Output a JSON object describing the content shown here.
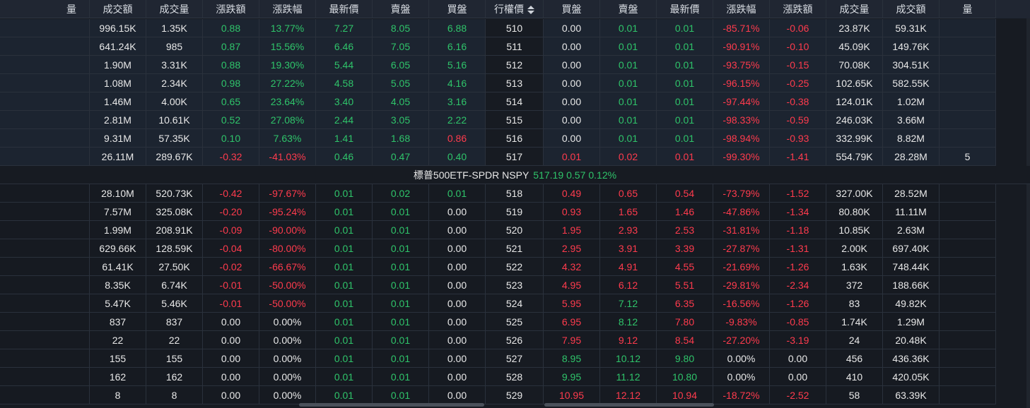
{
  "columns": [
    {
      "key": "c0",
      "label": "量"
    },
    {
      "key": "c1",
      "label": "成交額"
    },
    {
      "key": "c2",
      "label": "成交量"
    },
    {
      "key": "c3",
      "label": "漲跌額"
    },
    {
      "key": "c4",
      "label": "漲跌幅"
    },
    {
      "key": "c5",
      "label": "最新價"
    },
    {
      "key": "c6",
      "label": "賣盤"
    },
    {
      "key": "c7",
      "label": "買盤"
    },
    {
      "key": "c8",
      "label": "行權價"
    },
    {
      "key": "c9",
      "label": "買盤"
    },
    {
      "key": "c10",
      "label": "賣盤"
    },
    {
      "key": "c11",
      "label": "最新價"
    },
    {
      "key": "c12",
      "label": "漲跌幅"
    },
    {
      "key": "c13",
      "label": "漲跌額"
    },
    {
      "key": "c14",
      "label": "成交量"
    },
    {
      "key": "c15",
      "label": "成交額"
    },
    {
      "key": "c16",
      "label": "量"
    }
  ],
  "underlying": {
    "name": "標普500ETF-SPDR NSPY",
    "price": "517.19",
    "change": "0.57",
    "pct": "0.12%"
  },
  "rows_top": [
    {
      "call": [
        "",
        "996.15K",
        "1.35K",
        "0.88",
        "13.77%",
        "7.27",
        "8.05",
        "6.88"
      ],
      "strike": "510",
      "put": [
        "0.00",
        "0.01",
        "0.01",
        "-85.71%",
        "-0.06",
        "23.87K",
        "59.31K",
        ""
      ],
      "cc": [
        "nu",
        "nu",
        "nu",
        "up",
        "up",
        "up",
        "up",
        "up"
      ],
      "pc": [
        "nu",
        "up",
        "up",
        "dn",
        "dn",
        "nu",
        "nu",
        "nu"
      ]
    },
    {
      "call": [
        "",
        "641.24K",
        "985",
        "0.87",
        "15.56%",
        "6.46",
        "7.05",
        "6.16"
      ],
      "strike": "511",
      "put": [
        "0.00",
        "0.01",
        "0.01",
        "-90.91%",
        "-0.10",
        "45.09K",
        "149.76K",
        ""
      ],
      "cc": [
        "nu",
        "nu",
        "nu",
        "up",
        "up",
        "up",
        "up",
        "up"
      ],
      "pc": [
        "nu",
        "up",
        "up",
        "dn",
        "dn",
        "nu",
        "nu",
        "nu"
      ]
    },
    {
      "call": [
        "",
        "1.90M",
        "3.31K",
        "0.88",
        "19.30%",
        "5.44",
        "6.05",
        "5.16"
      ],
      "strike": "512",
      "put": [
        "0.00",
        "0.01",
        "0.01",
        "-93.75%",
        "-0.15",
        "70.08K",
        "304.51K",
        ""
      ],
      "cc": [
        "nu",
        "nu",
        "nu",
        "up",
        "up",
        "up",
        "up",
        "up"
      ],
      "pc": [
        "nu",
        "up",
        "up",
        "dn",
        "dn",
        "nu",
        "nu",
        "nu"
      ]
    },
    {
      "call": [
        "",
        "1.08M",
        "2.34K",
        "0.98",
        "27.22%",
        "4.58",
        "5.05",
        "4.16"
      ],
      "strike": "513",
      "put": [
        "0.00",
        "0.01",
        "0.01",
        "-96.15%",
        "-0.25",
        "102.65K",
        "582.55K",
        ""
      ],
      "cc": [
        "nu",
        "nu",
        "nu",
        "up",
        "up",
        "up",
        "up",
        "up"
      ],
      "pc": [
        "nu",
        "up",
        "up",
        "dn",
        "dn",
        "nu",
        "nu",
        "nu"
      ]
    },
    {
      "call": [
        "",
        "1.46M",
        "4.00K",
        "0.65",
        "23.64%",
        "3.40",
        "4.05",
        "3.16"
      ],
      "strike": "514",
      "put": [
        "0.00",
        "0.01",
        "0.01",
        "-97.44%",
        "-0.38",
        "124.01K",
        "1.02M",
        ""
      ],
      "cc": [
        "nu",
        "nu",
        "nu",
        "up",
        "up",
        "up",
        "up",
        "up"
      ],
      "pc": [
        "nu",
        "up",
        "up",
        "dn",
        "dn",
        "nu",
        "nu",
        "nu"
      ]
    },
    {
      "call": [
        "",
        "2.81M",
        "10.61K",
        "0.52",
        "27.08%",
        "2.44",
        "3.05",
        "2.22"
      ],
      "strike": "515",
      "put": [
        "0.00",
        "0.01",
        "0.01",
        "-98.33%",
        "-0.59",
        "246.03K",
        "3.66M",
        ""
      ],
      "cc": [
        "nu",
        "nu",
        "nu",
        "up",
        "up",
        "up",
        "up",
        "up"
      ],
      "pc": [
        "nu",
        "up",
        "up",
        "dn",
        "dn",
        "nu",
        "nu",
        "nu"
      ]
    },
    {
      "call": [
        "",
        "9.31M",
        "57.35K",
        "0.10",
        "7.63%",
        "1.41",
        "1.68",
        "0.86"
      ],
      "strike": "516",
      "put": [
        "0.00",
        "0.01",
        "0.01",
        "-98.94%",
        "-0.93",
        "332.99K",
        "8.82M",
        ""
      ],
      "cc": [
        "nu",
        "nu",
        "nu",
        "up",
        "up",
        "up",
        "up",
        "dn"
      ],
      "pc": [
        "nu",
        "up",
        "up",
        "dn",
        "dn",
        "nu",
        "nu",
        "nu"
      ]
    },
    {
      "call": [
        "",
        "26.11M",
        "289.67K",
        "-0.32",
        "-41.03%",
        "0.46",
        "0.47",
        "0.40"
      ],
      "strike": "517",
      "put": [
        "0.01",
        "0.02",
        "0.01",
        "-99.30%",
        "-1.41",
        "554.79K",
        "28.28M",
        "5"
      ],
      "cc": [
        "nu",
        "nu",
        "nu",
        "dn",
        "dn",
        "up",
        "up",
        "up"
      ],
      "pc": [
        "dn",
        "dn",
        "dn",
        "dn",
        "dn",
        "nu",
        "nu",
        "nu"
      ]
    }
  ],
  "rows_bottom": [
    {
      "call": [
        "",
        "28.10M",
        "520.73K",
        "-0.42",
        "-97.67%",
        "0.01",
        "0.02",
        "0.01"
      ],
      "strike": "518",
      "put": [
        "0.49",
        "0.65",
        "0.54",
        "-73.79%",
        "-1.52",
        "327.00K",
        "28.52M",
        ""
      ],
      "cc": [
        "nu",
        "nu",
        "nu",
        "dn",
        "dn",
        "up",
        "up",
        "up"
      ],
      "pc": [
        "dn",
        "dn",
        "dn",
        "dn",
        "dn",
        "nu",
        "nu",
        "nu"
      ]
    },
    {
      "call": [
        "",
        "7.57M",
        "325.08K",
        "-0.20",
        "-95.24%",
        "0.01",
        "0.01",
        "0.00"
      ],
      "strike": "519",
      "put": [
        "0.93",
        "1.65",
        "1.46",
        "-47.86%",
        "-1.34",
        "80.80K",
        "11.11M",
        ""
      ],
      "cc": [
        "nu",
        "nu",
        "nu",
        "dn",
        "dn",
        "up",
        "up",
        "nu"
      ],
      "pc": [
        "dn",
        "dn",
        "dn",
        "dn",
        "dn",
        "nu",
        "nu",
        "nu"
      ]
    },
    {
      "call": [
        "",
        "1.99M",
        "208.91K",
        "-0.09",
        "-90.00%",
        "0.01",
        "0.01",
        "0.00"
      ],
      "strike": "520",
      "put": [
        "1.95",
        "2.93",
        "2.53",
        "-31.81%",
        "-1.18",
        "10.85K",
        "2.63M",
        ""
      ],
      "cc": [
        "nu",
        "nu",
        "nu",
        "dn",
        "dn",
        "up",
        "up",
        "nu"
      ],
      "pc": [
        "dn",
        "dn",
        "dn",
        "dn",
        "dn",
        "nu",
        "nu",
        "nu"
      ]
    },
    {
      "call": [
        "",
        "629.66K",
        "128.59K",
        "-0.04",
        "-80.00%",
        "0.01",
        "0.01",
        "0.00"
      ],
      "strike": "521",
      "put": [
        "2.95",
        "3.91",
        "3.39",
        "-27.87%",
        "-1.31",
        "2.00K",
        "697.40K",
        ""
      ],
      "cc": [
        "nu",
        "nu",
        "nu",
        "dn",
        "dn",
        "up",
        "up",
        "nu"
      ],
      "pc": [
        "dn",
        "dn",
        "dn",
        "dn",
        "dn",
        "nu",
        "nu",
        "nu"
      ]
    },
    {
      "call": [
        "",
        "61.41K",
        "27.50K",
        "-0.02",
        "-66.67%",
        "0.01",
        "0.01",
        "0.00"
      ],
      "strike": "522",
      "put": [
        "4.32",
        "4.91",
        "4.55",
        "-21.69%",
        "-1.26",
        "1.63K",
        "748.44K",
        ""
      ],
      "cc": [
        "nu",
        "nu",
        "nu",
        "dn",
        "dn",
        "up",
        "up",
        "nu"
      ],
      "pc": [
        "dn",
        "dn",
        "dn",
        "dn",
        "dn",
        "nu",
        "nu",
        "nu"
      ]
    },
    {
      "call": [
        "",
        "8.35K",
        "6.74K",
        "-0.01",
        "-50.00%",
        "0.01",
        "0.01",
        "0.00"
      ],
      "strike": "523",
      "put": [
        "4.95",
        "6.12",
        "5.51",
        "-29.81%",
        "-2.34",
        "372",
        "188.66K",
        ""
      ],
      "cc": [
        "nu",
        "nu",
        "nu",
        "dn",
        "dn",
        "up",
        "up",
        "nu"
      ],
      "pc": [
        "dn",
        "dn",
        "dn",
        "dn",
        "dn",
        "nu",
        "nu",
        "nu"
      ]
    },
    {
      "call": [
        "",
        "5.47K",
        "5.46K",
        "-0.01",
        "-50.00%",
        "0.01",
        "0.01",
        "0.00"
      ],
      "strike": "524",
      "put": [
        "5.95",
        "7.12",
        "6.35",
        "-16.56%",
        "-1.26",
        "83",
        "49.82K",
        ""
      ],
      "cc": [
        "nu",
        "nu",
        "nu",
        "dn",
        "dn",
        "up",
        "up",
        "nu"
      ],
      "pc": [
        "dn",
        "up",
        "dn",
        "dn",
        "dn",
        "nu",
        "nu",
        "nu"
      ]
    },
    {
      "call": [
        "",
        "837",
        "837",
        "0.00",
        "0.00%",
        "0.01",
        "0.01",
        "0.00"
      ],
      "strike": "525",
      "put": [
        "6.95",
        "8.12",
        "7.80",
        "-9.83%",
        "-0.85",
        "1.74K",
        "1.29M",
        ""
      ],
      "cc": [
        "nu",
        "nu",
        "nu",
        "nu",
        "nu",
        "up",
        "up",
        "nu"
      ],
      "pc": [
        "dn",
        "up",
        "dn",
        "dn",
        "dn",
        "nu",
        "nu",
        "nu"
      ]
    },
    {
      "call": [
        "",
        "22",
        "22",
        "0.00",
        "0.00%",
        "0.01",
        "0.01",
        "0.00"
      ],
      "strike": "526",
      "put": [
        "7.95",
        "9.12",
        "8.54",
        "-27.20%",
        "-3.19",
        "24",
        "20.48K",
        ""
      ],
      "cc": [
        "nu",
        "nu",
        "nu",
        "nu",
        "nu",
        "up",
        "up",
        "nu"
      ],
      "pc": [
        "dn",
        "dn",
        "dn",
        "dn",
        "dn",
        "nu",
        "nu",
        "nu"
      ]
    },
    {
      "call": [
        "",
        "155",
        "155",
        "0.00",
        "0.00%",
        "0.01",
        "0.01",
        "0.00"
      ],
      "strike": "527",
      "put": [
        "8.95",
        "10.12",
        "9.80",
        "0.00%",
        "0.00",
        "456",
        "436.36K",
        ""
      ],
      "cc": [
        "nu",
        "nu",
        "nu",
        "nu",
        "nu",
        "up",
        "up",
        "nu"
      ],
      "pc": [
        "up",
        "up",
        "up",
        "nu",
        "nu",
        "nu",
        "nu",
        "nu"
      ]
    },
    {
      "call": [
        "",
        "162",
        "162",
        "0.00",
        "0.00%",
        "0.01",
        "0.01",
        "0.00"
      ],
      "strike": "528",
      "put": [
        "9.95",
        "11.12",
        "10.80",
        "0.00%",
        "0.00",
        "410",
        "420.05K",
        ""
      ],
      "cc": [
        "nu",
        "nu",
        "nu",
        "nu",
        "nu",
        "up",
        "up",
        "nu"
      ],
      "pc": [
        "up",
        "up",
        "up",
        "nu",
        "nu",
        "nu",
        "nu",
        "nu"
      ]
    },
    {
      "call": [
        "",
        "8",
        "8",
        "0.00",
        "0.00%",
        "0.01",
        "0.01",
        "0.00"
      ],
      "strike": "529",
      "put": [
        "10.95",
        "12.12",
        "10.94",
        "-18.72%",
        "-2.52",
        "58",
        "63.39K",
        ""
      ],
      "cc": [
        "nu",
        "nu",
        "nu",
        "nu",
        "nu",
        "up",
        "up",
        "nu"
      ],
      "pc": [
        "dn",
        "dn",
        "dn",
        "dn",
        "dn",
        "nu",
        "nu",
        "nu"
      ]
    }
  ]
}
